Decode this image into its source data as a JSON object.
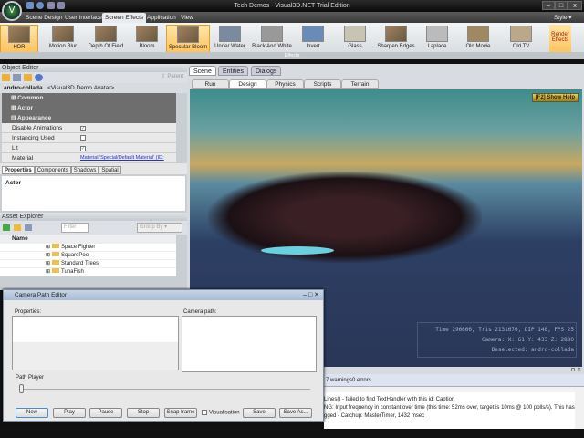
{
  "window": {
    "title": "Tech Demos - Visual3D.NET Trial Edition",
    "logo": "V",
    "style_label": "Style"
  },
  "menu_tabs": [
    "Scene Design",
    "User Interface",
    "Screen Effects",
    "Application",
    "View"
  ],
  "ribbon": {
    "effects": [
      "HDR",
      "Motion Blur",
      "Depth Of Field",
      "Bloom",
      "Specular Bloom",
      "Under Water",
      "Black And White",
      "Invert",
      "Glass",
      "Sharpen Edges",
      "Laplace",
      "Old Movie",
      "Old TV"
    ],
    "group_label": "Effects",
    "render_effects": "Render Effects"
  },
  "object_editor": {
    "title": "Object Editor",
    "parent_label": "Parent",
    "object_name": "andro-collada",
    "object_type": "<Visual3D.Demo.Avatar>",
    "categories": [
      "Common",
      "Actor",
      "Appearance"
    ],
    "properties": [
      {
        "name": "Disable Animations",
        "checked": true
      },
      {
        "name": "Instancing Used",
        "checked": false
      },
      {
        "name": "Lit",
        "checked": true
      }
    ],
    "material_label": "Material",
    "material_value": "Material 'Special/Default Material' (ID:",
    "tabs": [
      "Properties",
      "Components",
      "Shadows",
      "Spatial"
    ],
    "description": "Actor"
  },
  "asset_explorer": {
    "title": "Asset Explorer",
    "filter_placeholder": "Filter",
    "group_by": "Group By",
    "column": "Name",
    "items": [
      "Space Fighter",
      "SquarePool",
      "Standard Trees",
      "TunaFish"
    ]
  },
  "scene": {
    "top_tabs": [
      "Scene",
      "Entities",
      "Dialogs"
    ],
    "sub_tabs": [
      "Run",
      "Design",
      "Physics",
      "Scripts",
      "Terrain"
    ],
    "help": "[F2] Show Help",
    "stats": [
      "Time 296666, Tris 2131676, DIP 148, FPS 25",
      "Camera: X: 61 Y: 433 Z: 2880",
      "Deselected: andro-collada"
    ]
  },
  "log": {
    "summary": "7 warnings0 errors",
    "lines": [
      "Lines() - failed to find TextHandler with this id: Caption",
      "NG: Input frequency in constant over time (this time: 52ms over, target is 10ms @ 100 polls/s). This has occured ...",
      "gged - Catchup: MasterTimer, 1432 msec"
    ]
  },
  "camera_dialog": {
    "title": "Camera Path Editor",
    "properties_label": "Properties:",
    "camera_path_label": "Camera path:",
    "path_player_label": "Path Player",
    "slider_value": 0,
    "buttons": [
      "New",
      "Play",
      "Pause",
      "Stop",
      "Snap frame",
      "Save",
      "Save As..."
    ],
    "visualisation_label": "Visualisation",
    "visualisation_checked": false
  }
}
